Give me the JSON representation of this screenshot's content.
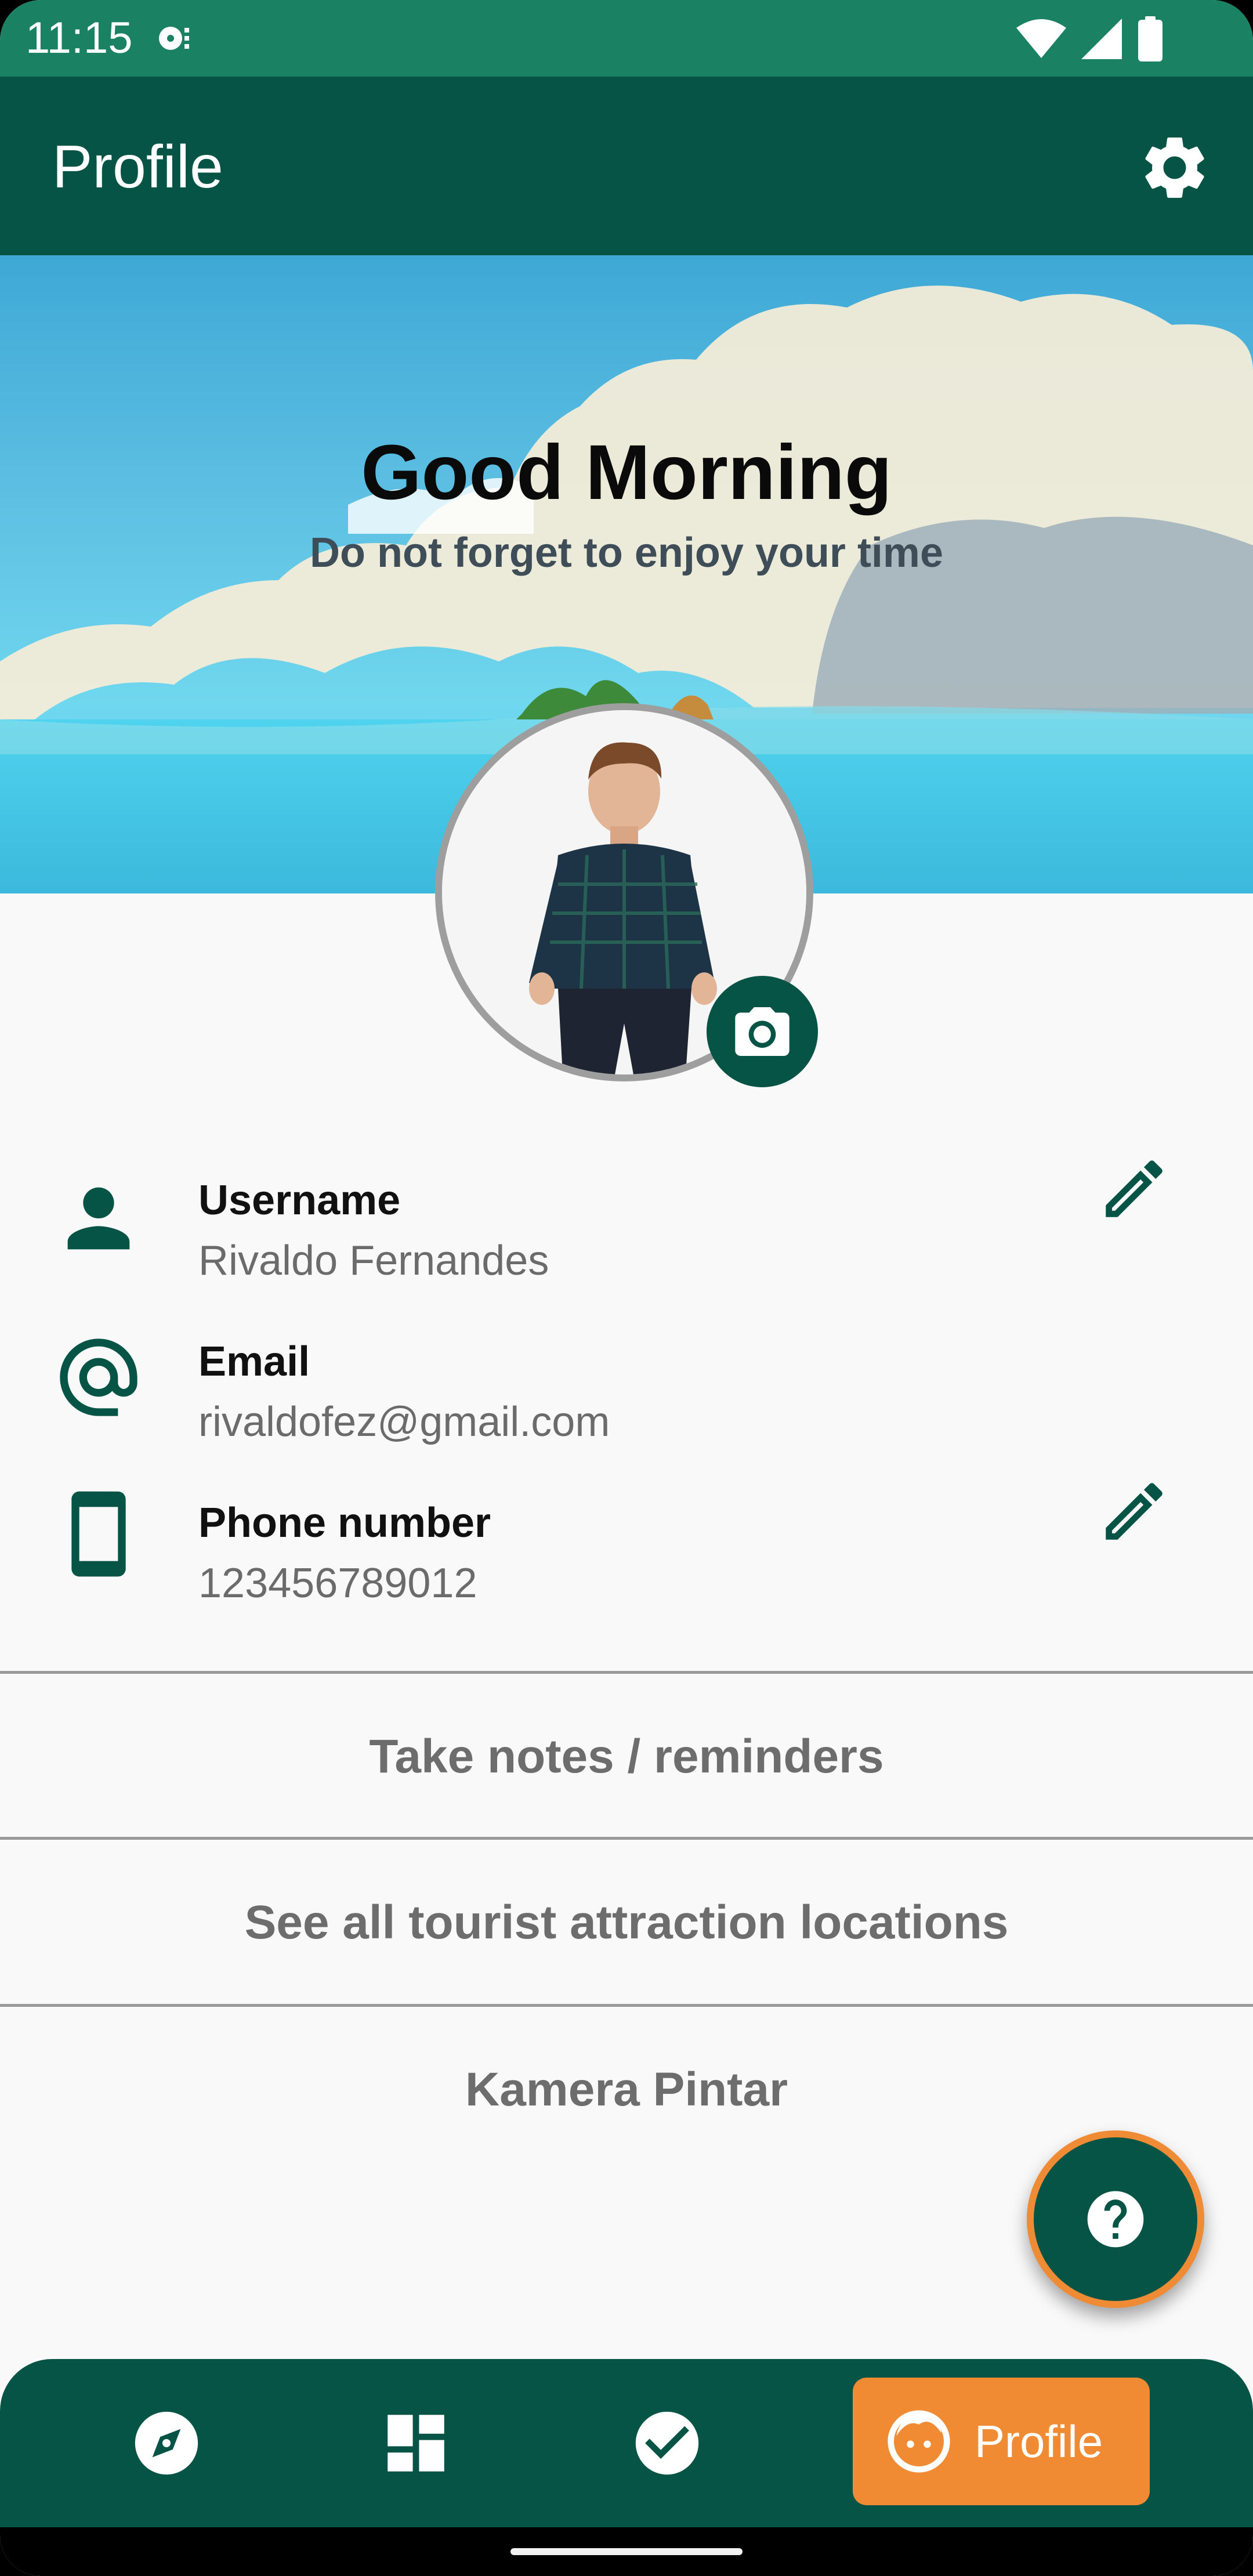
{
  "status_bar": {
    "time": "11:15",
    "icons": [
      "media-icon",
      "wifi-icon",
      "signal-icon",
      "battery-icon"
    ]
  },
  "app_bar": {
    "title": "Profile",
    "settings_icon": "gear-icon"
  },
  "banner": {
    "greeting": "Good Morning",
    "subtitle": "Do not forget to enjoy your time"
  },
  "profile": {
    "avatar_icon": "profile-photo",
    "camera_icon": "camera-icon",
    "fields": [
      {
        "label": "Username",
        "value": "Rivaldo Fernandes",
        "icon": "person-icon",
        "editable": true
      },
      {
        "label": "Email",
        "value": "rivaldofez@gmail.com",
        "icon": "at-sign-icon",
        "editable": false
      },
      {
        "label": "Phone number",
        "value": "123456789012",
        "icon": "phone-icon",
        "editable": true
      }
    ]
  },
  "menu": {
    "items": [
      {
        "label": "Take notes / reminders"
      },
      {
        "label": "See all tourist attraction locations"
      },
      {
        "label": "Kamera Pintar"
      }
    ]
  },
  "fab": {
    "icon": "help-icon"
  },
  "bottom_nav": {
    "items": [
      {
        "icon": "compass-icon"
      },
      {
        "icon": "dashboard-icon"
      },
      {
        "icon": "check-circle-icon"
      },
      {
        "icon": "face-icon",
        "label": "Profile",
        "active": true
      }
    ]
  },
  "colors": {
    "primary": "#065446",
    "status_bar": "#1a8162",
    "accent": "#f08a33",
    "background": "#f9f9f9",
    "text_muted": "#6d6d6d"
  }
}
